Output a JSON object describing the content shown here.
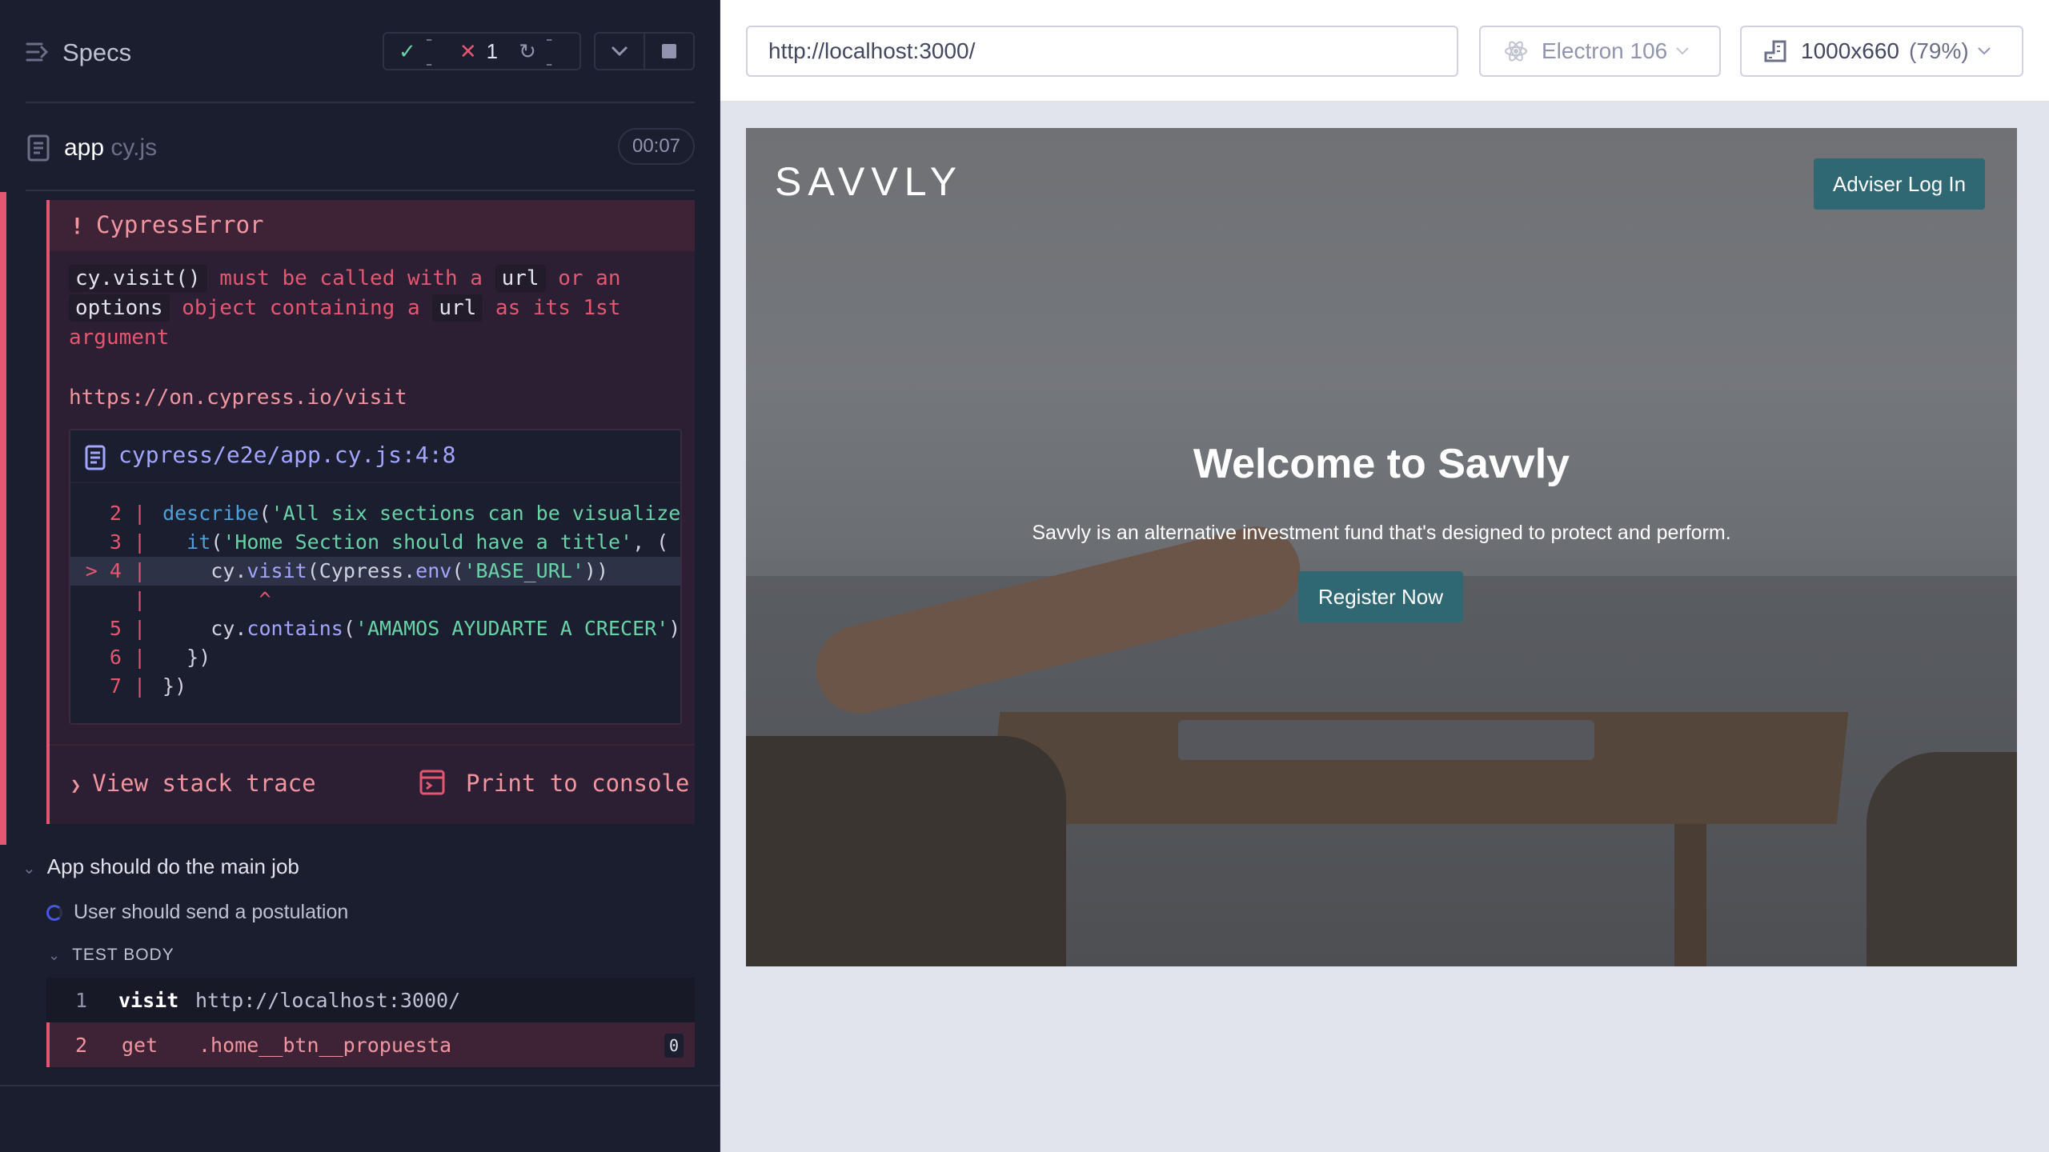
{
  "reporter": {
    "title": "Specs",
    "stats": {
      "passed": "--",
      "failed": "1",
      "pending": "--"
    },
    "spec": {
      "name": "app",
      "ext": " cy.js",
      "timer": "00:07"
    },
    "error": {
      "title": "CypressError",
      "bang": "!",
      "msg": {
        "code1": "cy.visit()",
        "t1": " must be called with a ",
        "code2": "url",
        "t2": " or an ",
        "code3": "options",
        "t3": " object containing a ",
        "code4": "url",
        "t4": " as its 1st argument"
      },
      "link": "https://on.cypress.io/visit",
      "code_frame": {
        "path": "cypress/e2e/app.cy.js:4:8",
        "lines": [
          {
            "n": "2",
            "marker": ""
          },
          {
            "n": "3",
            "marker": ""
          },
          {
            "n": "4",
            "marker": ">"
          },
          {
            "n": "",
            "marker": ""
          },
          {
            "n": "5",
            "marker": ""
          },
          {
            "n": "6",
            "marker": ""
          },
          {
            "n": "7",
            "marker": ""
          }
        ]
      },
      "stack_label": "View stack trace",
      "print_label": "Print to console"
    },
    "suite": "App should do the main job",
    "test": "User should send a postulation",
    "test_body": "TEST BODY",
    "commands": [
      {
        "num": "1",
        "name": "visit",
        "arg": "http://localhost:3000/",
        "badge": ""
      },
      {
        "num": "2",
        "name": "get",
        "arg": ".home__btn__propuesta",
        "badge": "0"
      }
    ]
  },
  "toolbar": {
    "url": "http://localhost:3000/",
    "browser": "Electron 106",
    "viewport": "1000x660",
    "zoom": "(79%)"
  },
  "aut": {
    "logo": "SAVVLY",
    "adviser_label": "Adviser Log In",
    "hero_title": "Welcome to Savvly",
    "hero_subtitle": "Savvly is an alternative investment fund that's designed to protect and perform.",
    "register_label": "Register Now"
  },
  "colors": {
    "fail": "#e45770",
    "pass": "#69d3a7",
    "accent": "#4956e3",
    "brand_button": "#2f6873"
  }
}
